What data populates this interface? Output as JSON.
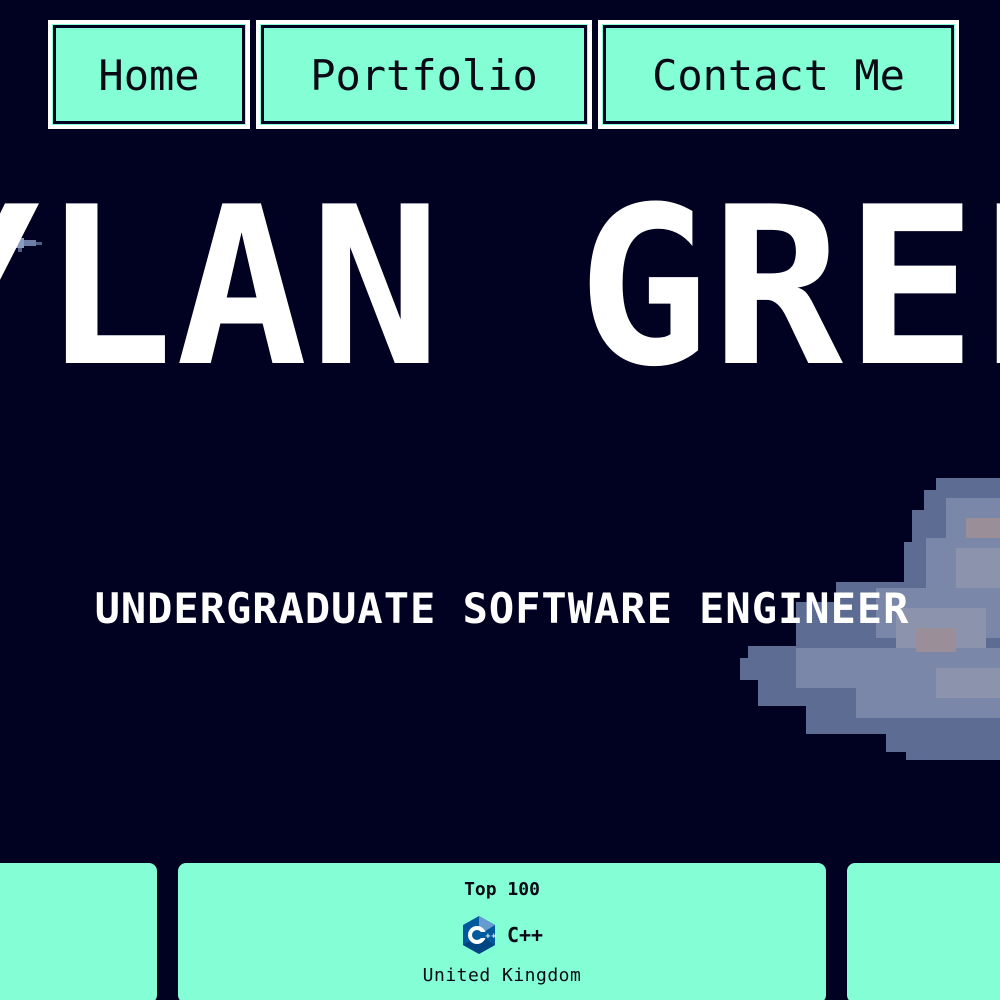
{
  "nav": {
    "home_label": "Home",
    "portfolio_label": "Portfolio",
    "contact_label": "Contact Me"
  },
  "hero": {
    "name_visible": "YLAN GREE",
    "subtitle": "UNDERGRADUATE SOFTWARE ENGINEER"
  },
  "cards": {
    "middle": {
      "rank": "Top 100",
      "language": "C++",
      "language_icon": "cpp-logo-icon",
      "country": "United Kingdom"
    }
  },
  "colors": {
    "background": "#010221",
    "accent": "#84fed5",
    "text_light": "#ffffff",
    "text_dark": "#0a0a14"
  }
}
